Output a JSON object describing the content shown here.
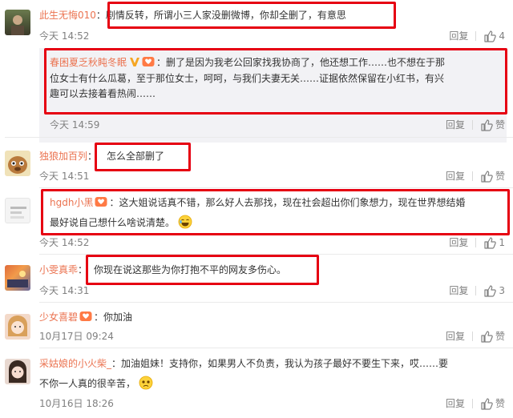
{
  "actions": {
    "reply_label": "回复",
    "like_label": "赞"
  },
  "comments": [
    {
      "username": "此生无悔010",
      "separator": "：",
      "text": "剧情反转，所谓小三人家没删微博，你却全删了，有意思",
      "time": "今天 14:52",
      "likes": "4"
    },
    {
      "username": "春困夏乏秋盹冬眠",
      "separator": "：",
      "text_line1": "删了是因为我老公回家找我协商了，他还想工作……也不想在于那",
      "text_line2": "位女士有什么瓜葛，至于那位女士，呵呵，与我们夫妻无关……证据依然保留在小红书，有兴",
      "text_line3": "趣可以去接着看热闹……",
      "time": "今天 14:59",
      "likes": ""
    },
    {
      "username": "独狼加百列",
      "separator": "：",
      "text": "怎么全部删了",
      "time": "今天 14:51",
      "likes": ""
    },
    {
      "username": "hgdh小黑",
      "separator": "：",
      "text_line1": "这大姐说话真不错，那么好人去那找，现在社会超出你们象想力，现在世界想结婚",
      "text_line2": "最好说自己想什么啥说清楚。",
      "time": "今天 14:52",
      "likes": "1"
    },
    {
      "username": "小雯真乖",
      "separator": "：",
      "text": "你现在说这那些为你打抱不平的网友多伤心。",
      "time": "今天 14:31",
      "likes": "3"
    },
    {
      "username": "少女喜碧",
      "separator": "：",
      "text": "你加油",
      "time": "10月17日 09:24",
      "likes": ""
    },
    {
      "username": "采姑娘的小火柴_",
      "separator": "：",
      "text_line1": "加油姐妹！支持你，如果男人不负责，我认为孩子最好不要生下来，哎……要",
      "text_line2": "不你一人真的很辛苦，",
      "time": "10月16日 18:26",
      "likes": ""
    }
  ],
  "colors": {
    "username": "#eb7350",
    "highlight_box": "#e60012",
    "meta": "#808080"
  }
}
